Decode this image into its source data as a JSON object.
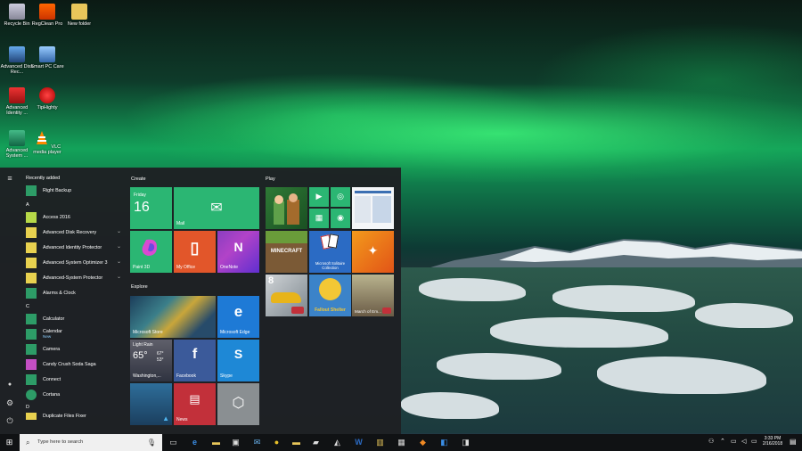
{
  "desktop": {
    "icons": [
      {
        "label": "Recycle Bin"
      },
      {
        "label": "RegClean Pro"
      },
      {
        "label": "New folder"
      },
      {
        "label": "Advanced Disk Rec..."
      },
      {
        "label": "Smart PC Care"
      },
      {
        "label": "Advanced Identity ..."
      },
      {
        "label": "TipHighty"
      },
      {
        "label": "Advanced System ..."
      },
      {
        "label": "VLC media player"
      }
    ]
  },
  "start_menu": {
    "recently_added_header": "Recently added",
    "recently_added": [
      {
        "label": "Right Backup"
      }
    ],
    "sections": [
      {
        "letter": "A",
        "apps": [
          {
            "label": "Access 2016"
          },
          {
            "label": "Advanced Disk Recovery"
          },
          {
            "label": "Advanced Identity Protector"
          },
          {
            "label": "Advanced System Optimizer 3"
          },
          {
            "label": "Advanced-System Protector"
          },
          {
            "label": "Alarms & Clock"
          }
        ]
      },
      {
        "letter": "C",
        "apps": [
          {
            "label": "Calculator"
          },
          {
            "label": "Calendar",
            "sub": "New"
          },
          {
            "label": "Camera"
          },
          {
            "label": "Candy Crush Soda Saga"
          },
          {
            "label": "Connect"
          },
          {
            "label": "Cortana"
          }
        ]
      },
      {
        "letter": "D",
        "apps": [
          {
            "label": "Duplicate Files Fixer"
          }
        ]
      }
    ],
    "groups": {
      "create": "Create",
      "explore": "Explore",
      "play": "Play"
    },
    "tiles": {
      "calendar_day": "Friday",
      "calendar_date": "16",
      "mail": "Mail",
      "paint3d": "Paint 3D",
      "my_office": "My Office",
      "onenote": "OneNote",
      "microsoft_store": "Microsoft Store",
      "microsoft_edge": "Microsoft Edge",
      "weather_cond": "Light Rain",
      "weather_temp": "65°",
      "weather_hi": "67°",
      "weather_lo": "53°",
      "weather_city": "Washington,...",
      "facebook": "Facebook",
      "skype": "Skype",
      "news": "News",
      "minecraft": "MINECRAFT",
      "solitaire": "Microsoft Solitaire Collection",
      "asphalt_num": "8",
      "fallout": "Fallout Shelter",
      "march_of_empires": "March of Em..."
    }
  },
  "taskbar": {
    "search_placeholder": "Type here to search",
    "time": "3:33 PM",
    "date": "2/16/2018"
  }
}
